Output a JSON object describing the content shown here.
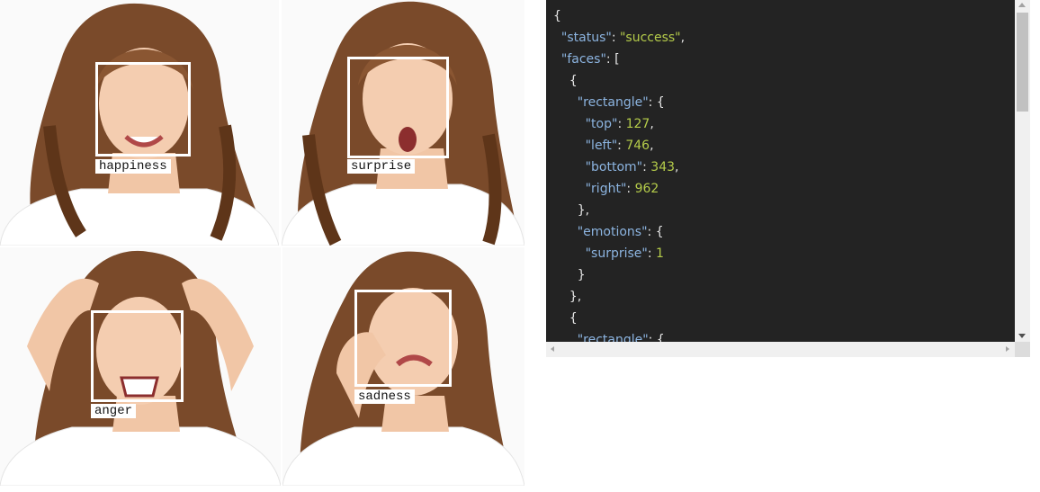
{
  "photos": [
    {
      "label": "happiness"
    },
    {
      "label": "surprise"
    },
    {
      "label": "anger"
    },
    {
      "label": "sadness"
    }
  ],
  "json_view": {
    "lines": [
      "{",
      "  \"status\": \"success\",",
      "  \"faces\": [",
      "    {",
      "      \"rectangle\": {",
      "        \"top\": 127,",
      "        \"left\": 746,",
      "        \"bottom\": 343,",
      "        \"right\": 962",
      "      },",
      "      \"emotions\": {",
      "        \"surprise\": 1",
      "      }",
      "    },",
      "    {",
      "      \"rectangle\": {"
    ]
  },
  "colors": {
    "panel_bg": "#232323",
    "key": "#8cb4e0",
    "value": "#b5cc4a",
    "punct": "#e6e6e6"
  }
}
